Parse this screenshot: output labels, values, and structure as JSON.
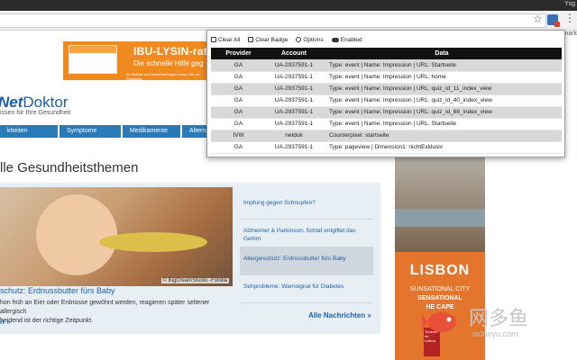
{
  "browser": {
    "user_label": "Ysg",
    "bookmarks_label": "kmark"
  },
  "ad": {
    "title": "IBU-LYSIN-rati",
    "subtitle": "Die schnelle Hilfe geg",
    "fine_print": "Zu Risiken und Nebenwirkungen lesen Sie die Packungs"
  },
  "site": {
    "logo_bold": "Net",
    "logo_plain": "Doktor",
    "tagline": "issen für Ihre Gesundheit",
    "nav": [
      "kheiten",
      "Symptome",
      "Medikamente",
      "Alternativmedizin"
    ]
  },
  "section": {
    "title": "lle Gesundheitsthemen"
  },
  "featured": {
    "image_credit": "© BigDreamStudio -Fotolia",
    "title": "schutz: Erdnussbutter fürs Baby",
    "text_line1": "hon früh an Eier oder Erdnüsse gewöhnt werden, reagieren später seltener allergisch",
    "text_line2": "heidend ist der richtige Zeitpunkt.",
    "more": "n »"
  },
  "news_list": [
    {
      "label": "Impfung gegen Schnupfen?"
    },
    {
      "label": "Alzheimer & Parkinson: Schlaf entgiftet das Gehirn"
    },
    {
      "label": "Allergieschutz: Erdnussbutter fürs Baby"
    },
    {
      "label": "Sehprobleme: Warnsignal für Diabetes"
    }
  ],
  "all_news_label": "Alle Nachrichten »",
  "lisbon_ad": {
    "name": "LISBON",
    "line2": "SUNSATIONAL CITY",
    "line3": "SENSATIONAL",
    "line4": "HE       CAPE",
    "badge": "Turismo de Lisboa"
  },
  "watermark": {
    "cn": "网多鱼",
    "en": "wduoyu.com"
  },
  "popup": {
    "toolbar": {
      "clear_all": "Clear All",
      "clear_badge": "Clear Badge",
      "options": "Options",
      "enabled": "Enabled"
    },
    "columns": [
      "Provider",
      "Account",
      "Data"
    ],
    "rows": [
      {
        "provider": "GA",
        "account": "UA-2937591-1",
        "data": "Type: event | Name: Impression | URL: Startseite"
      },
      {
        "provider": "GA",
        "account": "UA-2937591-1",
        "data": "Type: event | Name: Impression | URL: home"
      },
      {
        "provider": "GA",
        "account": "UA-2937591-1",
        "data": "Type: event | Name: Impression | URL: quiz_id_11_index_view"
      },
      {
        "provider": "GA",
        "account": "UA-2937591-1",
        "data": "Type: event | Name: Impression | URL: quiz_id_40_index_view"
      },
      {
        "provider": "GA",
        "account": "UA-2937591-1",
        "data": "Type: event | Name: Impression | URL: quiz_id_68_index_view"
      },
      {
        "provider": "GA",
        "account": "UA-2937591-1",
        "data": "Type: event | Name: Impression | URL: Startseite"
      },
      {
        "provider": "IVW",
        "account": "netdok",
        "data": "Counterpixel: startseite"
      },
      {
        "provider": "GA",
        "account": "UA-2937591-1",
        "data": "Type: pageview | Dimension1: nichtExklusiv"
      }
    ]
  }
}
